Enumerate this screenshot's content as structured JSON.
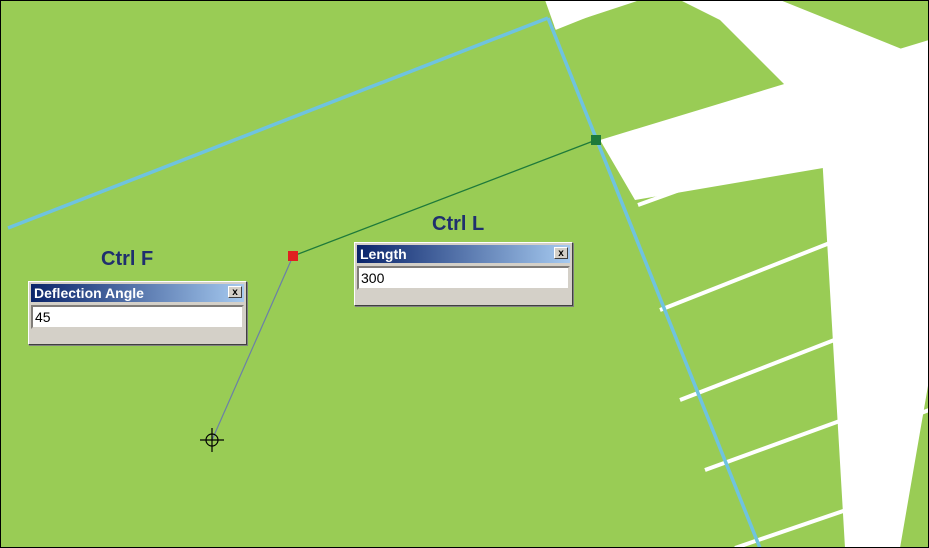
{
  "colors": {
    "parcel_fill": "#99cc55",
    "road": "#ffffff",
    "boundary_line": "#6fc3df",
    "sketch_line_left": "#6b7fa8",
    "sketch_line_right": "#1e7a3a",
    "vertex_red": "#e02020",
    "vertex_green": "#1e7a3a"
  },
  "hints": {
    "deflection_shortcut": "Ctrl F",
    "length_shortcut": "Ctrl L"
  },
  "deflection_dialog": {
    "title": "Deflection Angle",
    "close_label": "x",
    "value": "45"
  },
  "length_dialog": {
    "title": "Length",
    "close_label": "x",
    "value": "300"
  },
  "icons": {
    "cursor": "crosshair-cursor-icon"
  }
}
